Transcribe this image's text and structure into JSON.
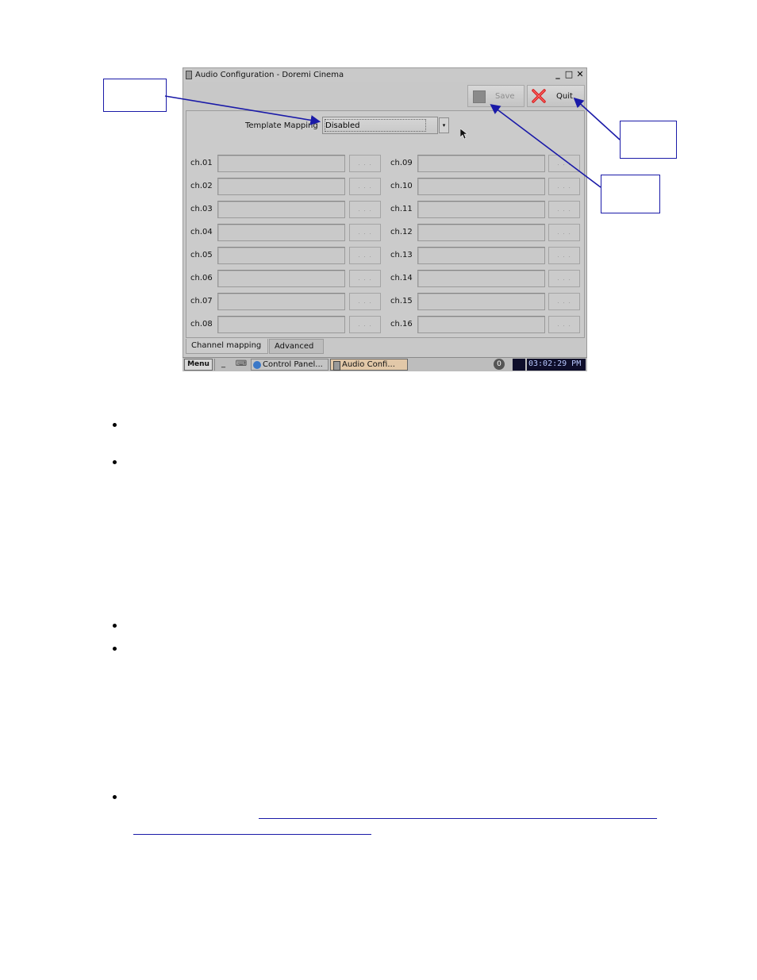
{
  "window": {
    "title": "Audio Configuration - Doremi Cinema",
    "controls": {
      "minimize": "_",
      "maximize": "□",
      "close": "✕"
    }
  },
  "toolbar": {
    "save_label": "Save",
    "quit_label": "Quit"
  },
  "template_mapping": {
    "label": "Template Mapping",
    "value": "Disabled",
    "arrow": "▾"
  },
  "channels": {
    "browse_label": ". . .",
    "left": [
      "ch.01",
      "ch.02",
      "ch.03",
      "ch.04",
      "ch.05",
      "ch.06",
      "ch.07",
      "ch.08"
    ],
    "right": [
      "ch.09",
      "ch.10",
      "ch.11",
      "ch.12",
      "ch.13",
      "ch.14",
      "ch.15",
      "ch.16"
    ]
  },
  "tabs": {
    "channel_mapping": "Channel mapping",
    "advanced": "Advanced"
  },
  "taskbar": {
    "menu": "Menu",
    "minimize": "_",
    "keyboard": "⌨",
    "control_panel": "Control Panel...",
    "audio_config": "Audio Confi...",
    "info": "0",
    "clock": "03:02:29 PM"
  },
  "colors": {
    "callout_border": "#1a1aa8",
    "window_bg": "#c8c8c8",
    "clock_bg": "#0e0e2a"
  }
}
